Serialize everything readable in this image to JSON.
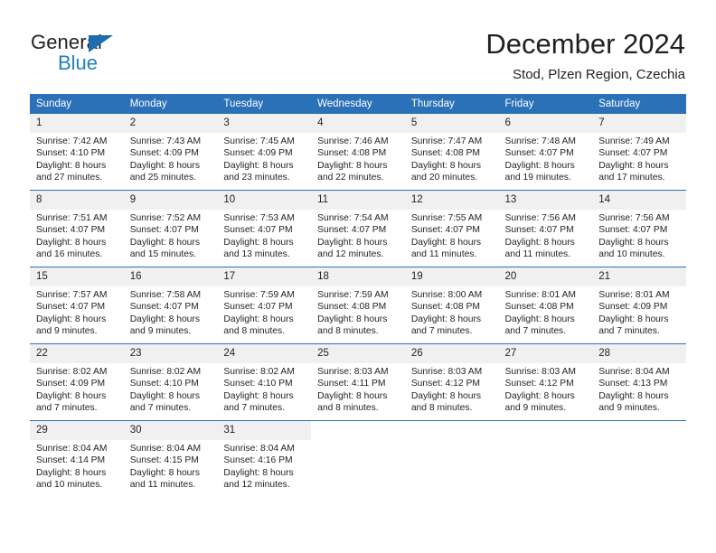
{
  "brand": {
    "name_part1": "General",
    "name_part2": "Blue",
    "triangle_color": "#1f6cb0",
    "blue_color": "#1f7fc4"
  },
  "header": {
    "month_title": "December 2024",
    "location": "Stod, Plzen Region, Czechia"
  },
  "theme": {
    "header_bg": "#2b71b8",
    "daynum_bg": "#f0f0f0",
    "row_divider": "#2b71b8"
  },
  "weekday_headers": [
    "Sunday",
    "Monday",
    "Tuesday",
    "Wednesday",
    "Thursday",
    "Friday",
    "Saturday"
  ],
  "weeks": [
    [
      {
        "day": "1",
        "sunrise": "Sunrise: 7:42 AM",
        "sunset": "Sunset: 4:10 PM",
        "daylight1": "Daylight: 8 hours",
        "daylight2": "and 27 minutes."
      },
      {
        "day": "2",
        "sunrise": "Sunrise: 7:43 AM",
        "sunset": "Sunset: 4:09 PM",
        "daylight1": "Daylight: 8 hours",
        "daylight2": "and 25 minutes."
      },
      {
        "day": "3",
        "sunrise": "Sunrise: 7:45 AM",
        "sunset": "Sunset: 4:09 PM",
        "daylight1": "Daylight: 8 hours",
        "daylight2": "and 23 minutes."
      },
      {
        "day": "4",
        "sunrise": "Sunrise: 7:46 AM",
        "sunset": "Sunset: 4:08 PM",
        "daylight1": "Daylight: 8 hours",
        "daylight2": "and 22 minutes."
      },
      {
        "day": "5",
        "sunrise": "Sunrise: 7:47 AM",
        "sunset": "Sunset: 4:08 PM",
        "daylight1": "Daylight: 8 hours",
        "daylight2": "and 20 minutes."
      },
      {
        "day": "6",
        "sunrise": "Sunrise: 7:48 AM",
        "sunset": "Sunset: 4:07 PM",
        "daylight1": "Daylight: 8 hours",
        "daylight2": "and 19 minutes."
      },
      {
        "day": "7",
        "sunrise": "Sunrise: 7:49 AM",
        "sunset": "Sunset: 4:07 PM",
        "daylight1": "Daylight: 8 hours",
        "daylight2": "and 17 minutes."
      }
    ],
    [
      {
        "day": "8",
        "sunrise": "Sunrise: 7:51 AM",
        "sunset": "Sunset: 4:07 PM",
        "daylight1": "Daylight: 8 hours",
        "daylight2": "and 16 minutes."
      },
      {
        "day": "9",
        "sunrise": "Sunrise: 7:52 AM",
        "sunset": "Sunset: 4:07 PM",
        "daylight1": "Daylight: 8 hours",
        "daylight2": "and 15 minutes."
      },
      {
        "day": "10",
        "sunrise": "Sunrise: 7:53 AM",
        "sunset": "Sunset: 4:07 PM",
        "daylight1": "Daylight: 8 hours",
        "daylight2": "and 13 minutes."
      },
      {
        "day": "11",
        "sunrise": "Sunrise: 7:54 AM",
        "sunset": "Sunset: 4:07 PM",
        "daylight1": "Daylight: 8 hours",
        "daylight2": "and 12 minutes."
      },
      {
        "day": "12",
        "sunrise": "Sunrise: 7:55 AM",
        "sunset": "Sunset: 4:07 PM",
        "daylight1": "Daylight: 8 hours",
        "daylight2": "and 11 minutes."
      },
      {
        "day": "13",
        "sunrise": "Sunrise: 7:56 AM",
        "sunset": "Sunset: 4:07 PM",
        "daylight1": "Daylight: 8 hours",
        "daylight2": "and 11 minutes."
      },
      {
        "day": "14",
        "sunrise": "Sunrise: 7:56 AM",
        "sunset": "Sunset: 4:07 PM",
        "daylight1": "Daylight: 8 hours",
        "daylight2": "and 10 minutes."
      }
    ],
    [
      {
        "day": "15",
        "sunrise": "Sunrise: 7:57 AM",
        "sunset": "Sunset: 4:07 PM",
        "daylight1": "Daylight: 8 hours",
        "daylight2": "and 9 minutes."
      },
      {
        "day": "16",
        "sunrise": "Sunrise: 7:58 AM",
        "sunset": "Sunset: 4:07 PM",
        "daylight1": "Daylight: 8 hours",
        "daylight2": "and 9 minutes."
      },
      {
        "day": "17",
        "sunrise": "Sunrise: 7:59 AM",
        "sunset": "Sunset: 4:07 PM",
        "daylight1": "Daylight: 8 hours",
        "daylight2": "and 8 minutes."
      },
      {
        "day": "18",
        "sunrise": "Sunrise: 7:59 AM",
        "sunset": "Sunset: 4:08 PM",
        "daylight1": "Daylight: 8 hours",
        "daylight2": "and 8 minutes."
      },
      {
        "day": "19",
        "sunrise": "Sunrise: 8:00 AM",
        "sunset": "Sunset: 4:08 PM",
        "daylight1": "Daylight: 8 hours",
        "daylight2": "and 7 minutes."
      },
      {
        "day": "20",
        "sunrise": "Sunrise: 8:01 AM",
        "sunset": "Sunset: 4:08 PM",
        "daylight1": "Daylight: 8 hours",
        "daylight2": "and 7 minutes."
      },
      {
        "day": "21",
        "sunrise": "Sunrise: 8:01 AM",
        "sunset": "Sunset: 4:09 PM",
        "daylight1": "Daylight: 8 hours",
        "daylight2": "and 7 minutes."
      }
    ],
    [
      {
        "day": "22",
        "sunrise": "Sunrise: 8:02 AM",
        "sunset": "Sunset: 4:09 PM",
        "daylight1": "Daylight: 8 hours",
        "daylight2": "and 7 minutes."
      },
      {
        "day": "23",
        "sunrise": "Sunrise: 8:02 AM",
        "sunset": "Sunset: 4:10 PM",
        "daylight1": "Daylight: 8 hours",
        "daylight2": "and 7 minutes."
      },
      {
        "day": "24",
        "sunrise": "Sunrise: 8:02 AM",
        "sunset": "Sunset: 4:10 PM",
        "daylight1": "Daylight: 8 hours",
        "daylight2": "and 7 minutes."
      },
      {
        "day": "25",
        "sunrise": "Sunrise: 8:03 AM",
        "sunset": "Sunset: 4:11 PM",
        "daylight1": "Daylight: 8 hours",
        "daylight2": "and 8 minutes."
      },
      {
        "day": "26",
        "sunrise": "Sunrise: 8:03 AM",
        "sunset": "Sunset: 4:12 PM",
        "daylight1": "Daylight: 8 hours",
        "daylight2": "and 8 minutes."
      },
      {
        "day": "27",
        "sunrise": "Sunrise: 8:03 AM",
        "sunset": "Sunset: 4:12 PM",
        "daylight1": "Daylight: 8 hours",
        "daylight2": "and 9 minutes."
      },
      {
        "day": "28",
        "sunrise": "Sunrise: 8:04 AM",
        "sunset": "Sunset: 4:13 PM",
        "daylight1": "Daylight: 8 hours",
        "daylight2": "and 9 minutes."
      }
    ],
    [
      {
        "day": "29",
        "sunrise": "Sunrise: 8:04 AM",
        "sunset": "Sunset: 4:14 PM",
        "daylight1": "Daylight: 8 hours",
        "daylight2": "and 10 minutes."
      },
      {
        "day": "30",
        "sunrise": "Sunrise: 8:04 AM",
        "sunset": "Sunset: 4:15 PM",
        "daylight1": "Daylight: 8 hours",
        "daylight2": "and 11 minutes."
      },
      {
        "day": "31",
        "sunrise": "Sunrise: 8:04 AM",
        "sunset": "Sunset: 4:16 PM",
        "daylight1": "Daylight: 8 hours",
        "daylight2": "and 12 minutes."
      },
      {
        "day": "",
        "sunrise": "",
        "sunset": "",
        "daylight1": "",
        "daylight2": ""
      },
      {
        "day": "",
        "sunrise": "",
        "sunset": "",
        "daylight1": "",
        "daylight2": ""
      },
      {
        "day": "",
        "sunrise": "",
        "sunset": "",
        "daylight1": "",
        "daylight2": ""
      },
      {
        "day": "",
        "sunrise": "",
        "sunset": "",
        "daylight1": "",
        "daylight2": ""
      }
    ]
  ]
}
